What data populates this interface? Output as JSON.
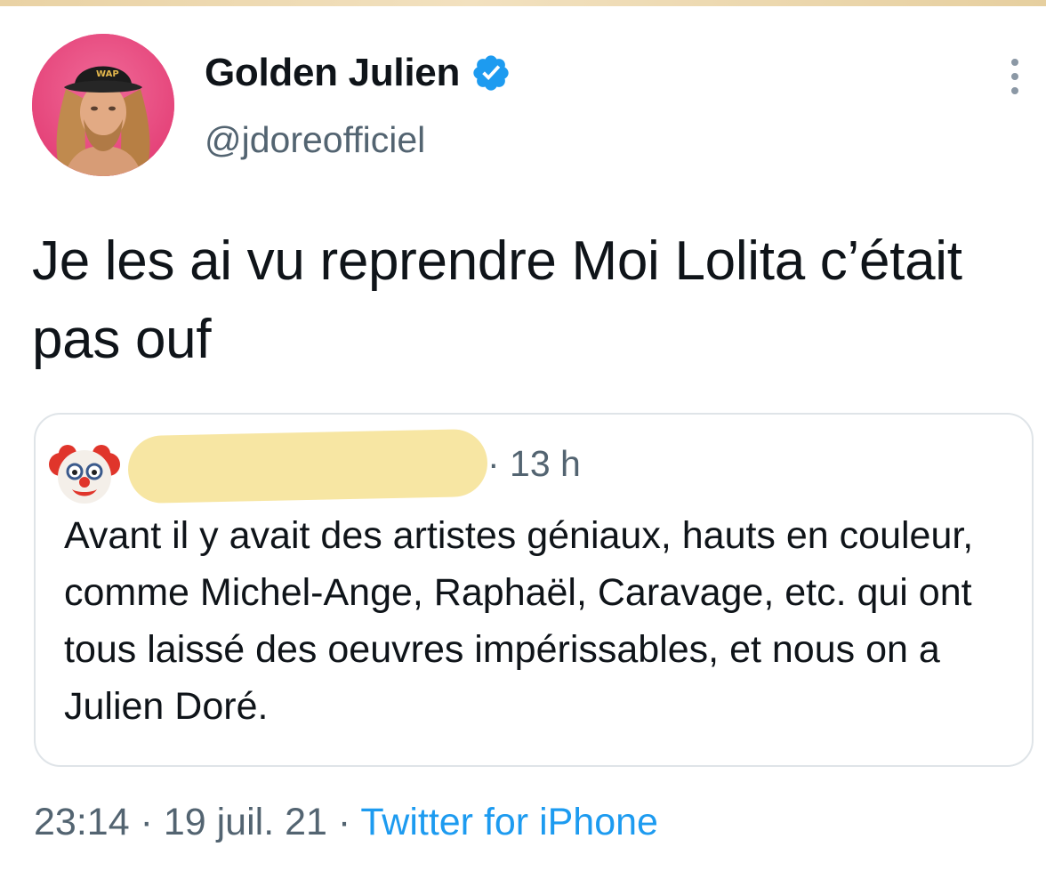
{
  "author": {
    "display_name": "Golden Julien",
    "handle": "@jdoreofficiel",
    "verified": true,
    "avatar_icon": "profile-photo",
    "avatar_cap_text": "WAP"
  },
  "tweet": {
    "text": "Je les ai vu reprendre Moi Lolita c’était pas ouf"
  },
  "quoted": {
    "avatar_icon": "clown-emoji",
    "time": "· 13 h",
    "text": "Avant il y avait des artistes géniaux, hauts en couleur, comme Michel-Ange, Raphaël, Caravage, etc. qui ont tous laissé des oeuvres impérissables, et nous on a Julien Doré."
  },
  "meta": {
    "time": "23:14",
    "separator": "·",
    "date": "19 juil. 21",
    "source": "Twitter for iPhone"
  },
  "colors": {
    "text": "#0f1419",
    "secondary": "#536471",
    "link": "#1d9bf0",
    "verified": "#1d9bf0",
    "avatar_bg": "#e8447b",
    "redaction": "#f7e6a3"
  }
}
